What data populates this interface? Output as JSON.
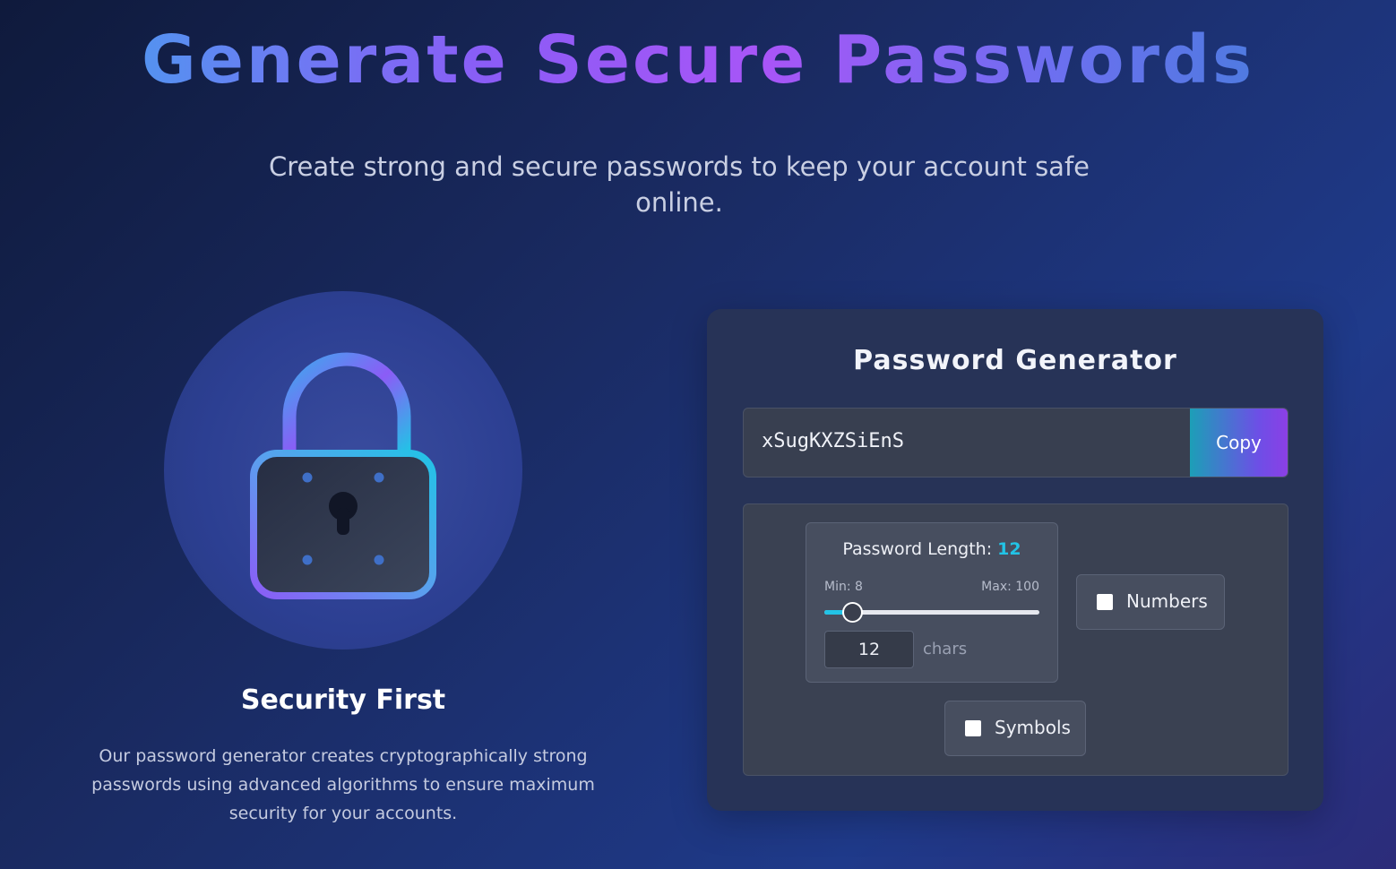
{
  "hero": {
    "title": "Generate Secure Passwords",
    "subtitle": "Create strong and secure passwords to keep your account safe online."
  },
  "feature": {
    "icon": "padlock-icon",
    "title": "Security First",
    "description": "Our password generator creates cryptographically strong passwords using advanced algorithms to ensure maximum security for your accounts."
  },
  "generator": {
    "title": "Password Generator",
    "password": "xSugKXZSiEnS",
    "copy_label": "Copy",
    "length": {
      "label": "Password Length:",
      "value": "12",
      "min_label": "Min: 8",
      "max_label": "Max: 100",
      "min": 8,
      "max": 100,
      "current": 12,
      "input_value": "12",
      "unit": "chars"
    },
    "options": {
      "numbers": {
        "label": "Numbers",
        "checked": false
      },
      "symbols": {
        "label": "Symbols",
        "checked": false
      }
    }
  },
  "colors": {
    "accent_cyan": "#22c3e6",
    "accent_purple": "#8b5cf6",
    "card_bg": "#273357"
  }
}
